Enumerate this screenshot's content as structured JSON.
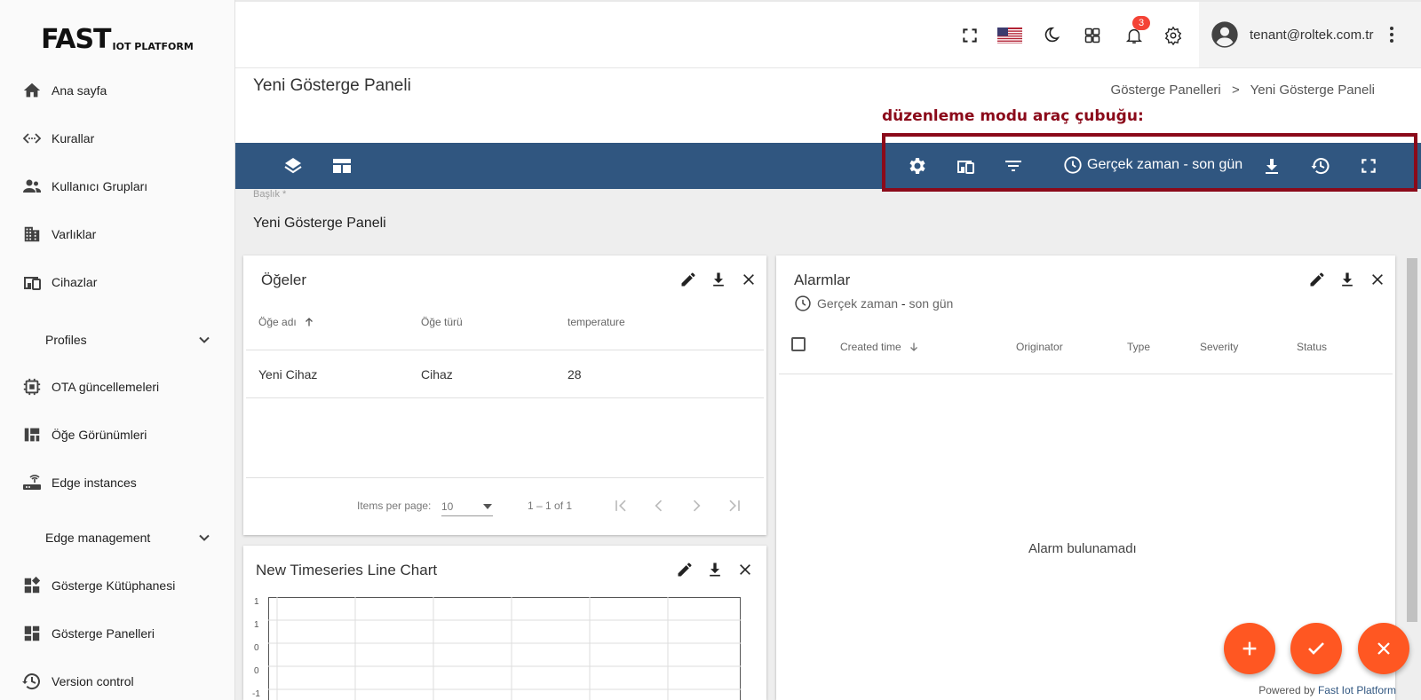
{
  "logo": {
    "main": "FAST",
    "sub": "IOT PLATFORM"
  },
  "sidebar": {
    "items": [
      {
        "label": "Ana sayfa",
        "icon": "home-icon"
      },
      {
        "label": "Kurallar",
        "icon": "code-arrows-icon"
      },
      {
        "label": "Kullanıcı Grupları",
        "icon": "people-icon"
      },
      {
        "label": "Varlıklar",
        "icon": "building-icon"
      },
      {
        "label": "Cihazlar",
        "icon": "devices-icon"
      },
      {
        "label": "Profiles",
        "icon": "chevron-down-icon",
        "section": true
      },
      {
        "label": "OTA güncellemeleri",
        "icon": "chip-icon"
      },
      {
        "label": "Öğe Görünümleri",
        "icon": "view-quilt-icon"
      },
      {
        "label": "Edge instances",
        "icon": "router-icon"
      },
      {
        "label": "Edge management",
        "icon": "chevron-down-icon",
        "section": true
      },
      {
        "label": "Gösterge Kütüphanesi",
        "icon": "widgets-icon"
      },
      {
        "label": "Gösterge Panelleri",
        "icon": "dashboard-icon"
      },
      {
        "label": "Version control",
        "icon": "history-icon"
      }
    ]
  },
  "topbar": {
    "notification_count": "3",
    "user_email": "tenant@roltek.com.tr"
  },
  "page": {
    "title": "Yeni Gösterge Paneli",
    "breadcrumb_parent": "Gösterge Panelleri",
    "breadcrumb_sep": ">",
    "breadcrumb_current": "Yeni Gösterge Paneli",
    "annotation": "düzenleme modu araç çubuğu:"
  },
  "toolbar": {
    "timewindow_label": "Gerçek zaman - son gün"
  },
  "title_field": {
    "label": "Başlık *",
    "value": "Yeni Gösterge Paneli"
  },
  "entities_widget": {
    "title": "Öğeler",
    "columns": [
      "Öğe adı",
      "Öğe türü",
      "temperature"
    ],
    "rows": [
      [
        "Yeni Cihaz",
        "Cihaz",
        "28"
      ]
    ],
    "items_per_page_label": "Items per page:",
    "items_per_page_value": "10",
    "range_label": "1 – 1 of 1"
  },
  "alarms_widget": {
    "title": "Alarmlar",
    "timewindow_prefix": "Gerçek zaman",
    "timewindow_sep": " - ",
    "timewindow_suffix": "son gün",
    "columns": [
      "Created time",
      "Originator",
      "Type",
      "Severity",
      "Status"
    ],
    "empty_text": "Alarm bulunamadı"
  },
  "chart_widget": {
    "title": "New Timeseries Line Chart",
    "y_ticks": [
      "1",
      "1",
      "0",
      "0",
      "-1"
    ]
  },
  "footer": {
    "powered_prefix": "Powered by",
    "powered_brand": "Fast Iot Platform"
  },
  "colors": {
    "toolbar": "#305680",
    "fab": "#ff5722",
    "annotation": "#8b0a1a",
    "badge": "#f44336"
  }
}
